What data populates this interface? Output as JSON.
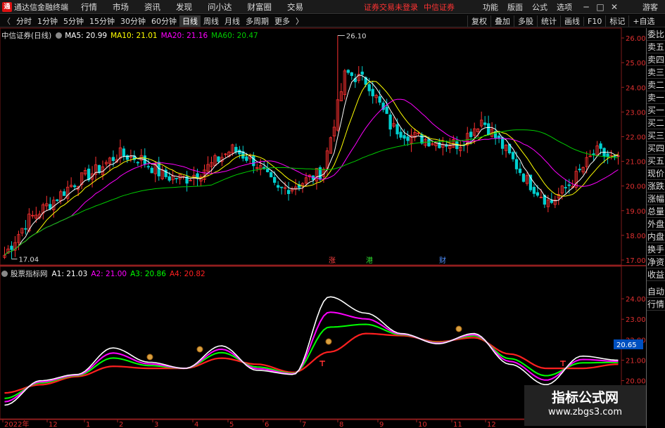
{
  "app": {
    "logo_text": "通",
    "title": "通达信金融终端"
  },
  "menu": [
    "行情",
    "市场",
    "资讯",
    "发现",
    "问小达",
    "财富圈",
    "交易"
  ],
  "login_status": "证券交易未登录",
  "broker": "中信证券",
  "right_menu": [
    "功能",
    "版面",
    "公式",
    "选项"
  ],
  "window_controls": [
    "─",
    "□",
    "✕"
  ],
  "guest": "游客",
  "periods": [
    "分时",
    "1分钟",
    "5分钟",
    "15分钟",
    "30分钟",
    "60分钟",
    "日线",
    "周线",
    "月线",
    "多周期",
    "更多"
  ],
  "active_period": "日线",
  "toolbar_right": [
    "复权",
    "叠加",
    "多股",
    "统计",
    "画线",
    "F10",
    "标记",
    "+自选"
  ],
  "toolbar_more_arrow": "〉",
  "toolbar_back": "〈",
  "main": {
    "title": "中信证券(日线)",
    "ma": [
      {
        "label": "MA5: 20.99",
        "color": "#ffffff"
      },
      {
        "label": "MA10: 21.01",
        "color": "#ffff00"
      },
      {
        "label": "MA20: 21.16",
        "color": "#ff00ff"
      },
      {
        "label": "MA60: 20.47",
        "color": "#00cc00"
      }
    ],
    "high_label": "26.10",
    "low_label": "17.04",
    "events": [
      "涨",
      "港",
      "财"
    ]
  },
  "sub": {
    "title": "股票指标网",
    "lines": [
      {
        "label": "A1: 21.03",
        "color": "#ffffff"
      },
      {
        "label": "A2: 21.00",
        "color": "#ff00ff"
      },
      {
        "label": "A3: 20.86",
        "color": "#00ff00"
      },
      {
        "label": "A4: 20.82",
        "color": "#ff2020"
      }
    ],
    "current_value": "20.65"
  },
  "x_axis": {
    "year_label": "2022年",
    "months": [
      "12",
      "1",
      "2",
      "3",
      "4",
      "5",
      "6",
      "7",
      "8",
      "9",
      "10",
      "11",
      "12"
    ]
  },
  "right_panel": [
    "委比",
    "卖五",
    "卖四",
    "卖三",
    "卖二",
    "卖一",
    "买一",
    "买二",
    "买三",
    "买四",
    "买五",
    "现价",
    "涨跌",
    "涨幅",
    "总量",
    "外盘",
    "内盘",
    "换手",
    "净资",
    "收益",
    "自动",
    "行情"
  ],
  "watermark": {
    "title": "指标公式网",
    "url": "www.zbgs3.com"
  },
  "chart_data": [
    {
      "type": "candlestick",
      "title": "中信证券(日线)",
      "y_ticks": [
        26.0,
        25.0,
        24.0,
        23.0,
        22.0,
        21.0,
        20.0,
        19.0,
        18.0,
        17.0
      ],
      "ylim": [
        16.8,
        26.4
      ],
      "x_categories": [
        "2022年",
        "12",
        "1",
        "2",
        "3",
        "4",
        "5",
        "6",
        "7",
        "8",
        "9",
        "10",
        "11",
        "12"
      ],
      "approx_close": [
        17.2,
        18.6,
        19.3,
        20.1,
        20.6,
        21.3,
        21.1,
        20.4,
        20.3,
        20.8,
        21.5,
        21.0,
        19.8,
        20.1,
        20.6,
        24.6,
        24.2,
        22.4,
        22.0,
        21.8,
        21.7,
        22.7,
        21.5,
        20.2,
        19.3,
        20.2,
        21.4,
        21.0
      ],
      "ma5_last": 20.99,
      "ma10_last": 21.01,
      "ma20_last": 21.16,
      "ma60_last": 20.47,
      "high": 26.1,
      "low": 17.04
    },
    {
      "type": "line",
      "title": "股票指标网",
      "y_ticks": [
        24.0,
        23.0,
        22.0,
        21.0,
        20.0
      ],
      "series": [
        {
          "name": "A1",
          "last": 21.03
        },
        {
          "name": "A2",
          "last": 21.0
        },
        {
          "name": "A3",
          "last": 20.86
        },
        {
          "name": "A4",
          "last": 20.82
        }
      ],
      "approx_a1": [
        18.8,
        20.0,
        20.3,
        21.6,
        20.9,
        20.6,
        21.7,
        20.5,
        20.3,
        24.1,
        23.3,
        22.3,
        21.8,
        22.3,
        20.8,
        19.8,
        21.2,
        21.0
      ],
      "approx_a4": [
        19.4,
        19.8,
        20.2,
        20.7,
        20.6,
        20.6,
        21.1,
        20.8,
        20.4,
        21.4,
        22.3,
        22.2,
        21.9,
        22.1,
        21.3,
        20.6,
        20.6,
        20.8
      ]
    }
  ]
}
